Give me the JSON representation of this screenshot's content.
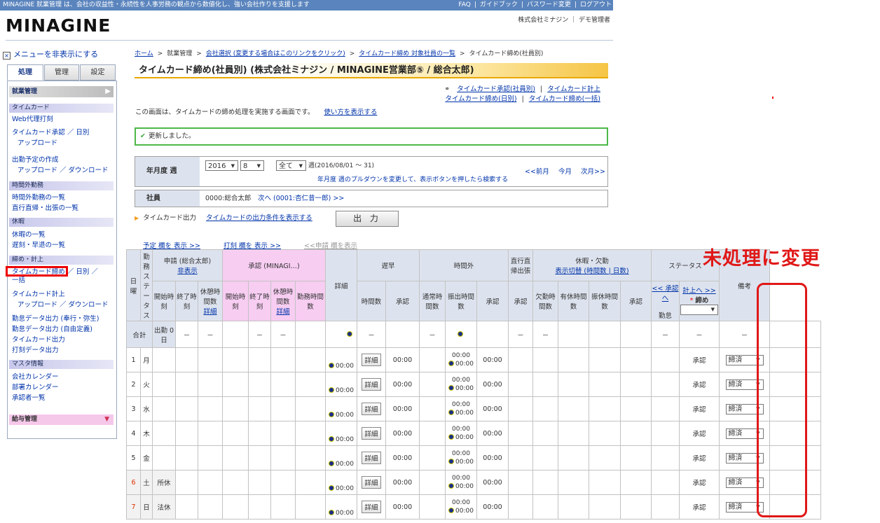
{
  "topbar": {
    "message": "MINAGINE 就業管理 は、会社の収益性・永続性を人事労務の観点から数値化し、強い会社作りを支援します",
    "links": [
      "FAQ",
      "ガイドブック",
      "パスワード変更",
      "ログアウト"
    ]
  },
  "logo": "MINAGINE",
  "company": "株式会社ミナジン ｜ デモ管理者",
  "sidebar": {
    "hide_menu": "メニューを非表示にする",
    "tabs": [
      "処理",
      "管理",
      "設定"
    ],
    "main_section": "就業管理",
    "sections": [
      {
        "title": "タイムカード",
        "items": [
          "Web代理打刻",
          "タイムカード承認 ／ 日別",
          "アップロード"
        ]
      },
      {
        "title": "",
        "items": [
          "出勤予定の作成",
          "アップロード ／ ダウンロード"
        ]
      },
      {
        "title": "時間外勤務",
        "items": [
          "時間外勤務の一覧",
          "直行直帰・出張の一覧"
        ]
      },
      {
        "title": "休暇",
        "items": [
          "休暇の一覧",
          "遅刻・早退の一覧"
        ]
      },
      {
        "title": "締め・計上",
        "items": [
          "タイムカード締め ／ 日別 ／",
          "一括",
          "タイムカード計上",
          "アップロード ／ ダウンロード",
          "勤怠データ出力 (奉行・弥生)",
          "勤怠データ出力 (自由定義)",
          "タイムカード出力",
          "打刻データ出力"
        ]
      },
      {
        "title": "マスタ情報",
        "items": [
          "会社カレンダー",
          "部署カレンダー",
          "承認者一覧"
        ]
      }
    ],
    "payroll": "給与管理"
  },
  "breadcrumb": [
    "ホーム",
    "就業管理",
    "会社選択 (変更する場合はこのリンクをクリック)",
    "タイムカード締め 対象社員の一覧",
    "タイムカード締め(社員別)"
  ],
  "page_title": "タイムカード締め(社員別) (株式会社ミナジン / MINAGINE営業部⑤ / 総合太郎)",
  "right_links": {
    "row1": [
      "タイムカード承認(社員別)",
      "タイムカード計上"
    ],
    "row2": [
      "タイムカード締め(日別)",
      "タイムカード締め(一括)"
    ]
  },
  "description": "この画面は、タイムカードの締め処理を実施する画面です。",
  "howto_link": "使い方を表示する",
  "success_message": "更新しました。",
  "period_form": {
    "label": "年月度 週",
    "year": "2016",
    "month": "8",
    "week": "全て",
    "week_suffix": "週(2016/08/01 ～ 31)",
    "hint": "年月度 週のプルダウンを変更して、表示ボタンを押したら検索する",
    "nav": [
      "<<前月",
      "今月",
      "次月>>"
    ]
  },
  "employee_form": {
    "label": "社員",
    "value": "0000:総合太郎",
    "next": "次へ (0001:杏仁昔一郎) >>"
  },
  "timecard_output": {
    "label": "タイムカード出力",
    "link": "タイムカードの出力条件を表示する",
    "button": "出 力"
  },
  "toggles": [
    "予定 欄を 表示 >>",
    "打刻 欄を 表示 >>",
    "<<申請 欄を表示"
  ],
  "grid": {
    "headers": {
      "day": "日",
      "weekday": "曜",
      "status": "勤務ステータス",
      "request": "申請 (総合太郎)",
      "request_toggle": "非表示",
      "approval": "承認 (MINAGI…)",
      "detail": "詳細",
      "late": "遅早",
      "overtime": "時間外",
      "direct": "直行直帰出張",
      "leave": "休暇・欠勤",
      "leave_toggle": "表示切替 (時間数 | 日数)",
      "status_col": "ステータス",
      "remarks": "備考",
      "start": "開始時刻",
      "end": "終了時刻",
      "break": "休憩時間数",
      "break_detail": "詳細",
      "work": "勤務時間数",
      "hours": "時間数",
      "approve": "承認",
      "normal": "通常時間数",
      "transfer": "振出時間数",
      "absence": "欠勤時間数",
      "paid": "有休時間数",
      "substitute": "振休時間数",
      "prev_approval": "<< 承認へ",
      "attendance": "勤怠",
      "next_post": "計上へ >>",
      "close": "締め"
    },
    "total": {
      "label": "合計",
      "days": "出勤 0日",
      "dash": "－",
      "close_select": ""
    },
    "rows": [
      {
        "day": "1",
        "weekday": "月",
        "status": "",
        "approval": "承認",
        "close": "締済",
        "time": "00:00"
      },
      {
        "day": "2",
        "weekday": "火",
        "status": "",
        "approval": "承認",
        "close": "締済",
        "time": "00:00"
      },
      {
        "day": "3",
        "weekday": "水",
        "status": "",
        "approval": "承認",
        "close": "締済",
        "time": "00:00"
      },
      {
        "day": "4",
        "weekday": "木",
        "status": "",
        "approval": "承認",
        "close": "締済",
        "time": "00:00"
      },
      {
        "day": "5",
        "weekday": "金",
        "status": "",
        "approval": "承認",
        "close": "締済",
        "time": "00:00"
      },
      {
        "day": "6",
        "weekday": "土",
        "status": "所休",
        "approval": "承認",
        "close": "締済",
        "time": "00:00"
      },
      {
        "day": "7",
        "weekday": "日",
        "status": "法休",
        "approval": "承認",
        "close": "締済",
        "time": "00:00"
      }
    ],
    "detail_button": "詳細"
  },
  "annotation": "未処理に変更",
  "colors": {
    "accent_red": "#e01818",
    "header_blue": "#5a84bd",
    "approval_pink": "#f7cdf2",
    "success_green": "#4cb848"
  }
}
